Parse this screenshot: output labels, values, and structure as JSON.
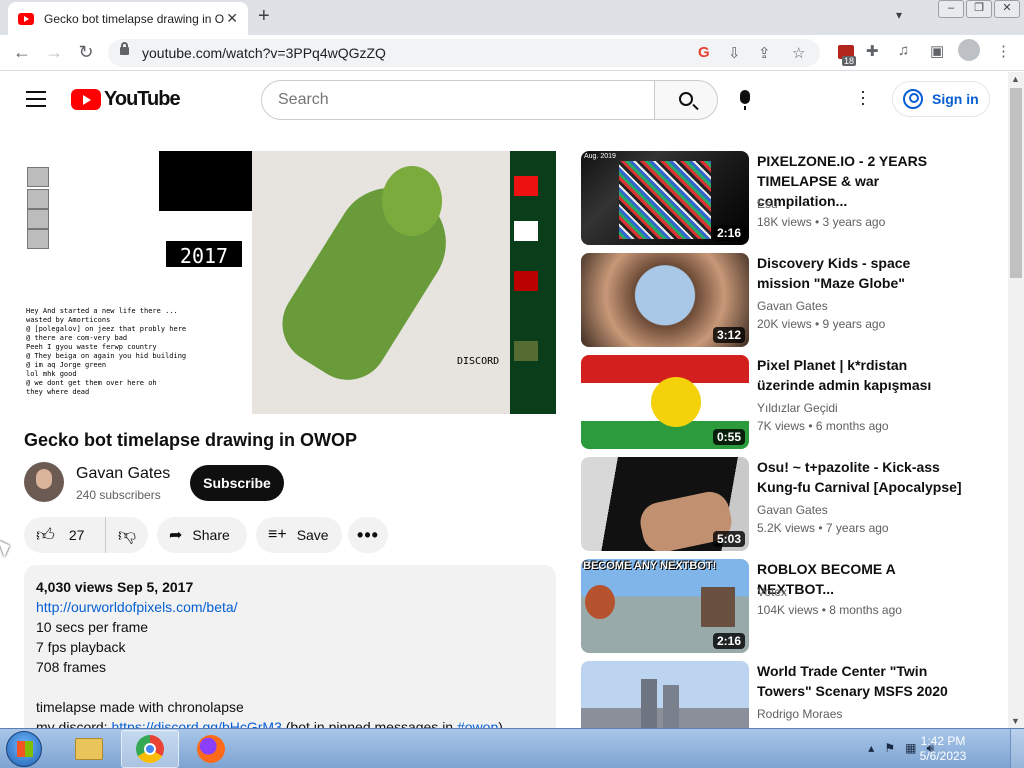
{
  "browser": {
    "tab_title": "Gecko bot timelapse drawing in O",
    "tab_close": "✕",
    "new_tab": "+",
    "url": "youtube.com/watch?v=3PPq4wQGzZQ",
    "ext_badge_count": "18",
    "window_controls": [
      "–",
      "❐",
      "✕"
    ]
  },
  "youtube": {
    "logo_text": "YouTube",
    "search_placeholder": "Search",
    "sign_in_label": "Sign in"
  },
  "player": {
    "year_label": "2017 !!",
    "canvas_text": "Hey And started a new life there ...\nwasted by Amorticons\n@ [polegalov] on jeez that probly here\n@ there are com-very bad\nPeeh I gyou waste ferwp country\n@ They beiga on again you hid building\n@ im aq Jorge green\nlol mhk good\n@ we dont get them over here oh\nthey where dead",
    "discord_tag": "DISCORD"
  },
  "video": {
    "title": "Gecko bot timelapse drawing in OWOP",
    "channel_name": "Gavan Gates",
    "subscribers": "240 subscribers",
    "subscribe_label": "Subscribe",
    "likes": "27",
    "share_label": "Share",
    "save_label": "Save",
    "more_label": "•••"
  },
  "description": {
    "meta": "4,030 views  Sep 5, 2017",
    "link": "http://ourworldofpixels.com/beta/",
    "line1": "10 secs per frame",
    "line2": "7 fps playback",
    "line3": "708 frames",
    "line4": "timelapse made with chronolapse",
    "discord_prefix": "my discord: ",
    "discord_link": "https://discord.gg/bHcGrM3",
    "discord_suffix": " (bot in pinned messages in ",
    "hashtag": "#owop",
    "discord_end": ")"
  },
  "recommendations": [
    {
      "title": "PIXELZONE.IO - 2 YEARS TIMELAPSE & war compilation...",
      "channel": "Esu",
      "stats": "18K views  •  3 years ago",
      "duration": "2:16",
      "thumb_label": "Aug. 2019"
    },
    {
      "title": "Discovery Kids - space mission \"Maze Globe\"",
      "channel": "Gavan Gates",
      "stats": "20K views  •  9 years ago",
      "duration": "3:12",
      "thumb_label": ""
    },
    {
      "title": "Pixel Planet | k*rdistan üzerinde admin kapışması",
      "channel": "Yıldızlar Geçidi",
      "stats": "7K views  •  6 months ago",
      "duration": "0:55",
      "thumb_label": ""
    },
    {
      "title": "Osu! ~ t+pazolite - Kick-ass Kung-fu Carnival [Apocalypse]",
      "channel": "Gavan Gates",
      "stats": "5.2K views  •  7 years ago",
      "duration": "5:03",
      "thumb_label": ""
    },
    {
      "title": "ROBLOX BECOME A NEXTBOT...",
      "channel": "Votex",
      "stats": "104K views  •  8 months ago",
      "duration": "2:16",
      "thumb_label": "BECOME ANY NEXTBOT!"
    },
    {
      "title": "World Trade Center \"Twin Towers\" Scenary MSFS 2020",
      "channel": "Rodrigo Moraes",
      "stats": "",
      "duration": "",
      "thumb_label": ""
    }
  ],
  "taskbar": {
    "time": "1:42 PM",
    "date": "5/6/2023"
  },
  "colors": {
    "youtube_red": "#ff0000",
    "link_blue": "#065fd4",
    "text_primary": "#0f0f0f",
    "text_secondary": "#606060"
  }
}
